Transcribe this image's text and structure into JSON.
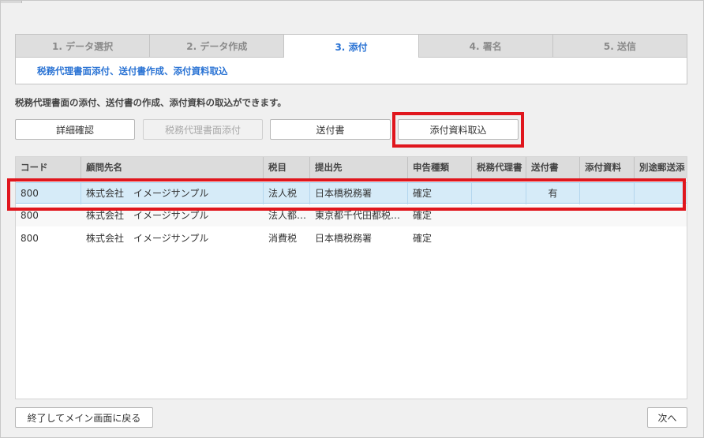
{
  "steps": [
    {
      "label": "1. データ選択"
    },
    {
      "label": "2. データ作成"
    },
    {
      "label": "3. 添付"
    },
    {
      "label": "4. 署名"
    },
    {
      "label": "5. 送信"
    }
  ],
  "step_subtitle": "税務代理書面添付、送付書作成、添付資料取込",
  "description": "税務代理書面の添付、送付書の作成、添付資料の取込ができます。",
  "toolbar": {
    "detail_label": "詳細確認",
    "attach_tax_agent_label": "税務代理書面添付",
    "cover_letter_label": "送付書",
    "import_attachments_label": "添付資料取込"
  },
  "table": {
    "columns": [
      "コード",
      "顧問先名",
      "税目",
      "提出先",
      "申告種類",
      "税務代理書",
      "送付書",
      "添付資料",
      "別途郵送添"
    ],
    "rows": [
      {
        "code": "800",
        "client": "株式会社　イメージサンプル",
        "tax": "法人税",
        "office": "日本橋税務署",
        "type": "確定",
        "agent": "",
        "cover": "有",
        "attach": "",
        "mail": ""
      },
      {
        "code": "800",
        "client": "株式会社　イメージサンプル",
        "tax": "法人都民税",
        "office": "東京都千代田都税事務所",
        "type": "確定",
        "agent": "",
        "cover": "",
        "attach": "",
        "mail": ""
      },
      {
        "code": "800",
        "client": "株式会社　イメージサンプル",
        "tax": "消費税",
        "office": "日本橋税務署",
        "type": "確定",
        "agent": "",
        "cover": "",
        "attach": "",
        "mail": ""
      }
    ]
  },
  "footer": {
    "exit_label": "終了してメイン画面に戻る",
    "next_label": "次へ"
  },
  "colors": {
    "active_step": "#2a73d4",
    "highlight": "#e0161d",
    "selected_row": "#d6ebf8"
  }
}
